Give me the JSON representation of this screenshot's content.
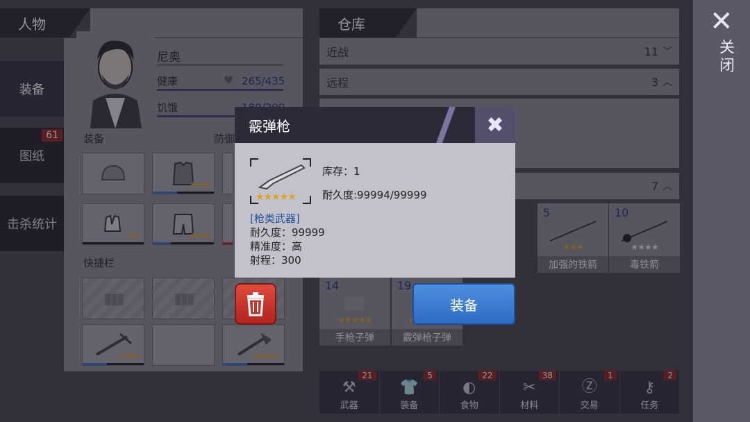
{
  "left_nav": {
    "header": "人物",
    "items": [
      {
        "label": "装备"
      },
      {
        "label": "图纸",
        "badge": "61"
      },
      {
        "label": "击杀统计"
      }
    ]
  },
  "character": {
    "name": "尼奥",
    "health_label": "健康",
    "health_value": "265/435",
    "hunger_label": "饥饿",
    "hunger_value": "180/200",
    "equip_label": "装备",
    "defense_label": "防御",
    "quickbar_label": "快捷栏"
  },
  "warehouse": {
    "title": "仓库",
    "melee_label": "近战",
    "melee_count": "11",
    "ranged_label": "远程",
    "ranged_count": "3",
    "ammo_count": "7",
    "items": [
      {
        "num": "5",
        "name": "加强的铁箭"
      },
      {
        "num": "10",
        "name": "毒铁箭"
      },
      {
        "num": "14",
        "name": "手枪子弹"
      },
      {
        "num": "19",
        "name": "霰弹枪子弹"
      }
    ]
  },
  "bottom_tabs": [
    {
      "label": "武器",
      "badge": "21",
      "icon": "axe-icon"
    },
    {
      "label": "装备",
      "badge": "5",
      "icon": "shirt-icon"
    },
    {
      "label": "食物",
      "badge": "22",
      "icon": "meat-icon"
    },
    {
      "label": "材料",
      "badge": "38",
      "icon": "material-icon"
    },
    {
      "label": "交易",
      "badge": "1",
      "icon": "coin-icon"
    },
    {
      "label": "任务",
      "badge": "2",
      "icon": "key-icon"
    }
  ],
  "close": {
    "label": "关闭"
  },
  "modal": {
    "title": "霰弹枪",
    "stock": "库存：1",
    "durability": "耐久度:99994/99999",
    "category": "[枪类武器]",
    "stat_durability": "耐久度：99999",
    "stat_accuracy": "精准度：高",
    "stat_range": "射程：300",
    "equip_button": "装备"
  },
  "colors": {
    "accent_blue": "#2e6bc4",
    "star_gold": "#e2a11f",
    "badge_red": "#8e2a26"
  }
}
